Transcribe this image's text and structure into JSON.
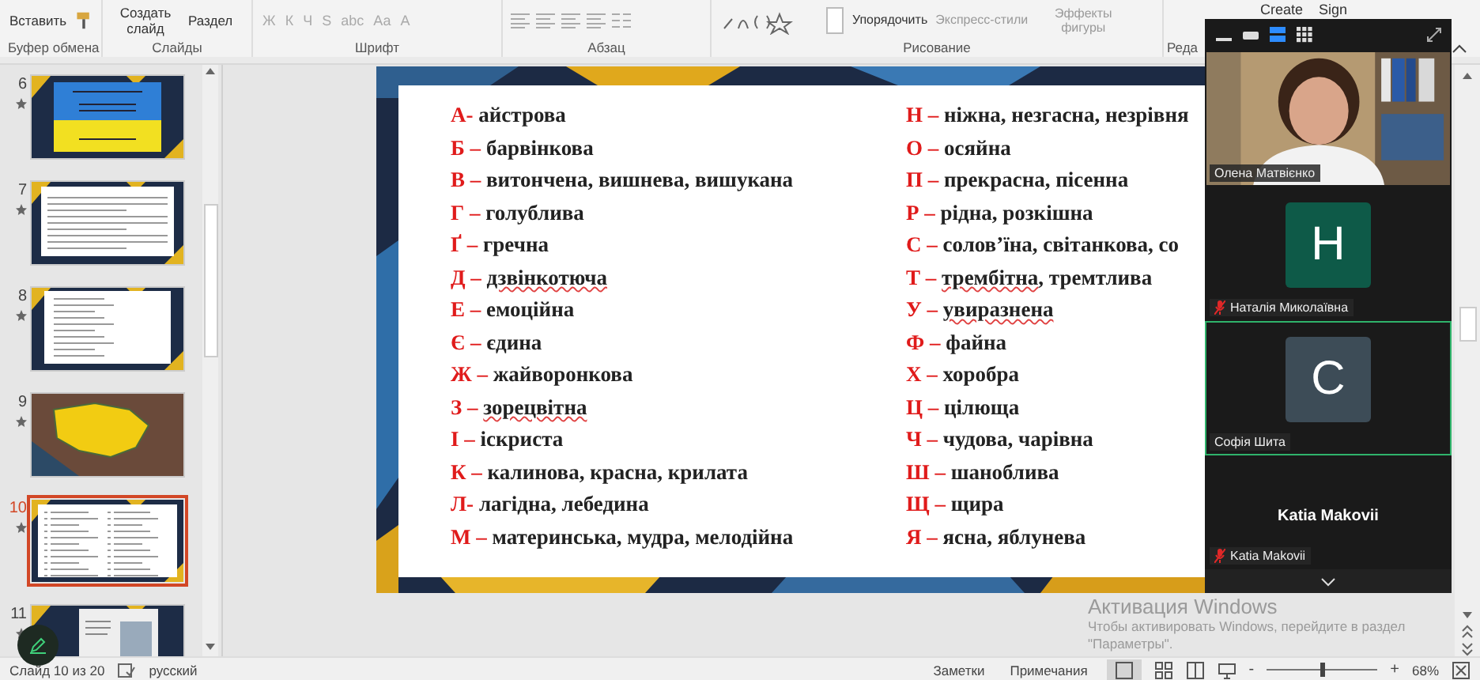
{
  "ribbon": {
    "groups": [
      {
        "kind": "clipboard",
        "label": "Буфер обмена",
        "buttons": [
          "Вставить"
        ]
      },
      {
        "kind": "slides",
        "label": "Слайды",
        "buttons": [
          "Создать слайд",
          "Раздел"
        ]
      },
      {
        "kind": "font",
        "label": "Шрифт",
        "buttons": [
          "Ж",
          "К",
          "Ч",
          "S",
          "abc",
          "Аа",
          "А"
        ]
      },
      {
        "kind": "paragraph",
        "label": "Абзац"
      },
      {
        "kind": "drawing",
        "label": "Рисование",
        "buttons": [
          "Упорядочить",
          "Экспресс-стили",
          "Эффекты фигуры"
        ]
      },
      {
        "kind": "editing",
        "label": "Реда"
      },
      {
        "kind": "addin",
        "buttons": [
          "Create",
          "Sign"
        ]
      }
    ]
  },
  "thumbnails": [
    {
      "number": "6",
      "kind": "title",
      "selected": false
    },
    {
      "number": "7",
      "kind": "text",
      "selected": false
    },
    {
      "number": "8",
      "kind": "list",
      "selected": false
    },
    {
      "number": "9",
      "kind": "map",
      "selected": false
    },
    {
      "number": "10",
      "kind": "columns",
      "selected": true
    },
    {
      "number": "11",
      "selected": false
    }
  ],
  "slide": {
    "columns": [
      [
        {
          "key": "А-",
          "parts": [
            {
              "text": "айстрова",
              "flagged": false
            }
          ]
        },
        {
          "key": "Б –",
          "parts": [
            {
              "text": "барвінкова",
              "flagged": false
            }
          ]
        },
        {
          "key": "В –",
          "parts": [
            {
              "text": "витончена, вишнева, вишукана",
              "flagged": false
            }
          ]
        },
        {
          "key": "Г –",
          "parts": [
            {
              "text": "голублива",
              "flagged": false
            }
          ]
        },
        {
          "key": "Ґ –",
          "parts": [
            {
              "text": "гречна",
              "flagged": false
            }
          ]
        },
        {
          "key": "Д –",
          "parts": [
            {
              "text": "дзвінкотюча",
              "flagged": true
            }
          ]
        },
        {
          "key": "Е –",
          "parts": [
            {
              "text": "емоційна",
              "flagged": false
            }
          ]
        },
        {
          "key": "Є –",
          "parts": [
            {
              "text": "єдина",
              "flagged": false
            }
          ]
        },
        {
          "key": "Ж –",
          "parts": [
            {
              "text": "жайворонкова",
              "flagged": false
            }
          ]
        },
        {
          "key": "З –",
          "parts": [
            {
              "text": "зорецвітна",
              "flagged": true
            }
          ]
        },
        {
          "key": "І –",
          "parts": [
            {
              "text": "іскриста",
              "flagged": false
            }
          ]
        },
        {
          "key": "К –",
          "parts": [
            {
              "text": "калинова, красна, крилата",
              "flagged": false
            }
          ]
        },
        {
          "key": "Л-",
          "parts": [
            {
              "text": "лагідна, лебедина",
              "flagged": false
            }
          ]
        },
        {
          "key": "М –",
          "parts": [
            {
              "text": "материнська, мудра, мелодійна",
              "flagged": false
            }
          ]
        }
      ],
      [
        {
          "key": "Н –",
          "parts": [
            {
              "text": "ніжна, незгасна, незрівня",
              "flagged": false
            }
          ]
        },
        {
          "key": "О –",
          "parts": [
            {
              "text": "осяйна",
              "flagged": false
            }
          ]
        },
        {
          "key": "П –",
          "parts": [
            {
              "text": "прекрасна, пісенна",
              "flagged": false
            }
          ]
        },
        {
          "key": "Р –",
          "parts": [
            {
              "text": "рідна, розкішна",
              "flagged": false
            }
          ]
        },
        {
          "key": "С –",
          "parts": [
            {
              "text": "солов’їна, світанкова, со",
              "flagged": false
            }
          ]
        },
        {
          "key": "Т –",
          "parts": [
            {
              "text": "трембітна",
              "flagged": true
            },
            {
              "text": ", тремтлива",
              "flagged": false
            }
          ]
        },
        {
          "key": "У –",
          "parts": [
            {
              "text": "увиразнена",
              "flagged": true
            }
          ]
        },
        {
          "key": "Ф –",
          "parts": [
            {
              "text": "файна",
              "flagged": false
            }
          ]
        },
        {
          "key": "Х –",
          "parts": [
            {
              "text": "хоробра",
              "flagged": false
            }
          ]
        },
        {
          "key": "Ц –",
          "parts": [
            {
              "text": "цілюща",
              "flagged": false
            }
          ]
        },
        {
          "key": "Ч –",
          "parts": [
            {
              "text": "чудова, чарівна",
              "flagged": false
            }
          ]
        },
        {
          "key": "Ш –",
          "parts": [
            {
              "text": "шаноблива",
              "flagged": false
            }
          ]
        },
        {
          "key": "Щ –",
          "parts": [
            {
              "text": "щира",
              "flagged": false
            }
          ]
        },
        {
          "key": "Я –",
          "parts": [
            {
              "text": "ясна, яблунева",
              "flagged": false
            }
          ]
        }
      ]
    ]
  },
  "meeting": {
    "view_modes": [
      {
        "selected": false
      },
      {
        "selected": false
      },
      {
        "selected": true
      },
      {
        "selected": false
      }
    ],
    "participants": [
      {
        "kind": "video",
        "name": "Олена Матвієнко",
        "speaking": false,
        "muted": false
      },
      {
        "kind": "avatar",
        "initial": "Н",
        "color": "#0e5a48",
        "name": "Наталія Миколаївна",
        "speaking": false,
        "muted": true
      },
      {
        "kind": "avatar",
        "initial": "С",
        "color": "#3d4c57",
        "name": "Софія Шита",
        "speaking": true,
        "muted": false
      },
      {
        "kind": "name",
        "display_name": "Katia Makovii",
        "name": "Katia Makovii",
        "speaking": false,
        "muted": true
      }
    ]
  },
  "activation": {
    "title": "Активация Windows",
    "text": "Чтобы активировать Windows, перейдите в раздел \"Параметры\"."
  },
  "status_bar": {
    "slide_info": "Слайд 10 из 20",
    "language": "русский",
    "notes": "Заметки",
    "comments": "Примечания",
    "zoom_out": "-",
    "zoom_slider": {
      "level": 0.5
    },
    "zoom_in": "+",
    "zoom": "68%"
  }
}
